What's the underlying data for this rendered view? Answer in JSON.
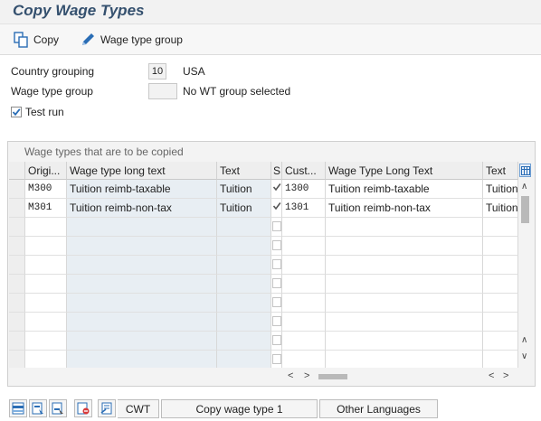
{
  "window": {
    "title": "Copy Wage Types"
  },
  "toolbar": {
    "copy_label": "Copy",
    "wage_type_group_label": "Wage type group"
  },
  "form": {
    "country_grouping_label": "Country grouping",
    "country_grouping_value": "10",
    "country_grouping_text": "USA",
    "wage_type_group_label": "Wage type group",
    "wage_type_group_value": "",
    "wage_type_group_text": "No WT group selected",
    "test_run_label": "Test run",
    "test_run_checked": true
  },
  "panel": {
    "title": "Wage types that are to be copied"
  },
  "table": {
    "headers": [
      "Origi...",
      "Wage type long text",
      "Text",
      "S",
      "Cust...",
      "Wage Type Long Text",
      "Text"
    ],
    "rows": [
      {
        "orig": "M300",
        "long_text": "Tuition reimb-taxable",
        "text": "Tuition",
        "selected": true,
        "cust": "1300",
        "cust_long_text": "Tuition reimb-taxable",
        "cust_text": "Tuition"
      },
      {
        "orig": "M301",
        "long_text": "Tuition reimb-non-tax",
        "text": "Tuition",
        "selected": true,
        "cust": "1301",
        "cust_long_text": "Tuition reimb-non-tax",
        "cust_text": "Tuition"
      }
    ],
    "empty_rows": 8
  },
  "bottom": {
    "cwt_label": "CWT",
    "copy_wage_type_label": "Copy wage type 1",
    "other_languages_label": "Other Languages"
  },
  "colors": {
    "title": "#34506e",
    "readonly_cell": "#e8eef3",
    "accent": "#2a6db5"
  },
  "icons": [
    "copy-icon",
    "pencil-icon",
    "checkbox-icon",
    "column-settings-icon",
    "select-all-icon",
    "select-block-icon",
    "deselect-icon",
    "delete-row-icon",
    "cwt-icon"
  ]
}
